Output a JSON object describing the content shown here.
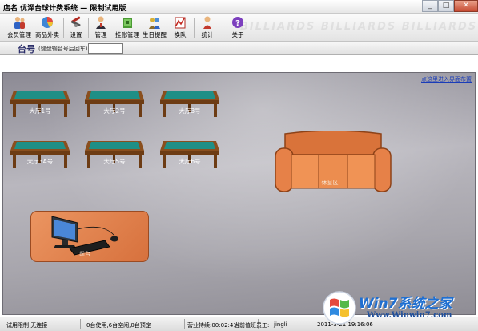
{
  "window": {
    "title": "店名 优泽台球计费系统 — 限制试用版",
    "controls": [
      "_",
      "□",
      "✕"
    ]
  },
  "toolbar": {
    "watermark": "BILLIARDS BILLIARDS BILLIARDS",
    "buttons": [
      {
        "label": "会员管理",
        "icon": "members-icon"
      },
      {
        "label": "商品外卖",
        "icon": "goods-icon"
      },
      {
        "label": "设置",
        "icon": "settings-icon"
      },
      {
        "label": "管理",
        "icon": "admin-icon"
      },
      {
        "label": "挂账管理",
        "icon": "credit-icon"
      },
      {
        "label": "生日提醒",
        "icon": "birthday-icon"
      },
      {
        "label": "换队",
        "icon": "swap-icon"
      },
      {
        "label": "统计",
        "icon": "stats-icon"
      },
      {
        "label": "关于",
        "icon": "about-icon"
      }
    ]
  },
  "table_entry": {
    "label": "台号",
    "hint": "(键盘输台号后回车)",
    "value": ""
  },
  "floor": {
    "layout_link": "点这里进入界面布置",
    "tables": [
      {
        "label": "大厅1号"
      },
      {
        "label": "大厅2号"
      },
      {
        "label": "大厅3号"
      },
      {
        "label": "大厅3A号"
      },
      {
        "label": "大厅5号"
      },
      {
        "label": "大厅6号"
      }
    ],
    "sofa_label": "休息区",
    "desk_label": "前台"
  },
  "status": {
    "trial": "试用限制 无连接",
    "tables": "0台使用,6台空闲,0台预定",
    "uptime": "营业持续:00:02:41",
    "staff_label": "当前值班员工:",
    "staff_name": "jingli",
    "datetime": "2011-3-21 19:16:06"
  },
  "watermark": {
    "brand": "Win7系统之家",
    "url": "Www.Winwin7.com"
  },
  "colors": {
    "cloth": "#1f8f86",
    "wood": "#8a4f1e",
    "sofa": "#e07a3e",
    "desk": "#e08752",
    "link": "#1a3cb8"
  }
}
